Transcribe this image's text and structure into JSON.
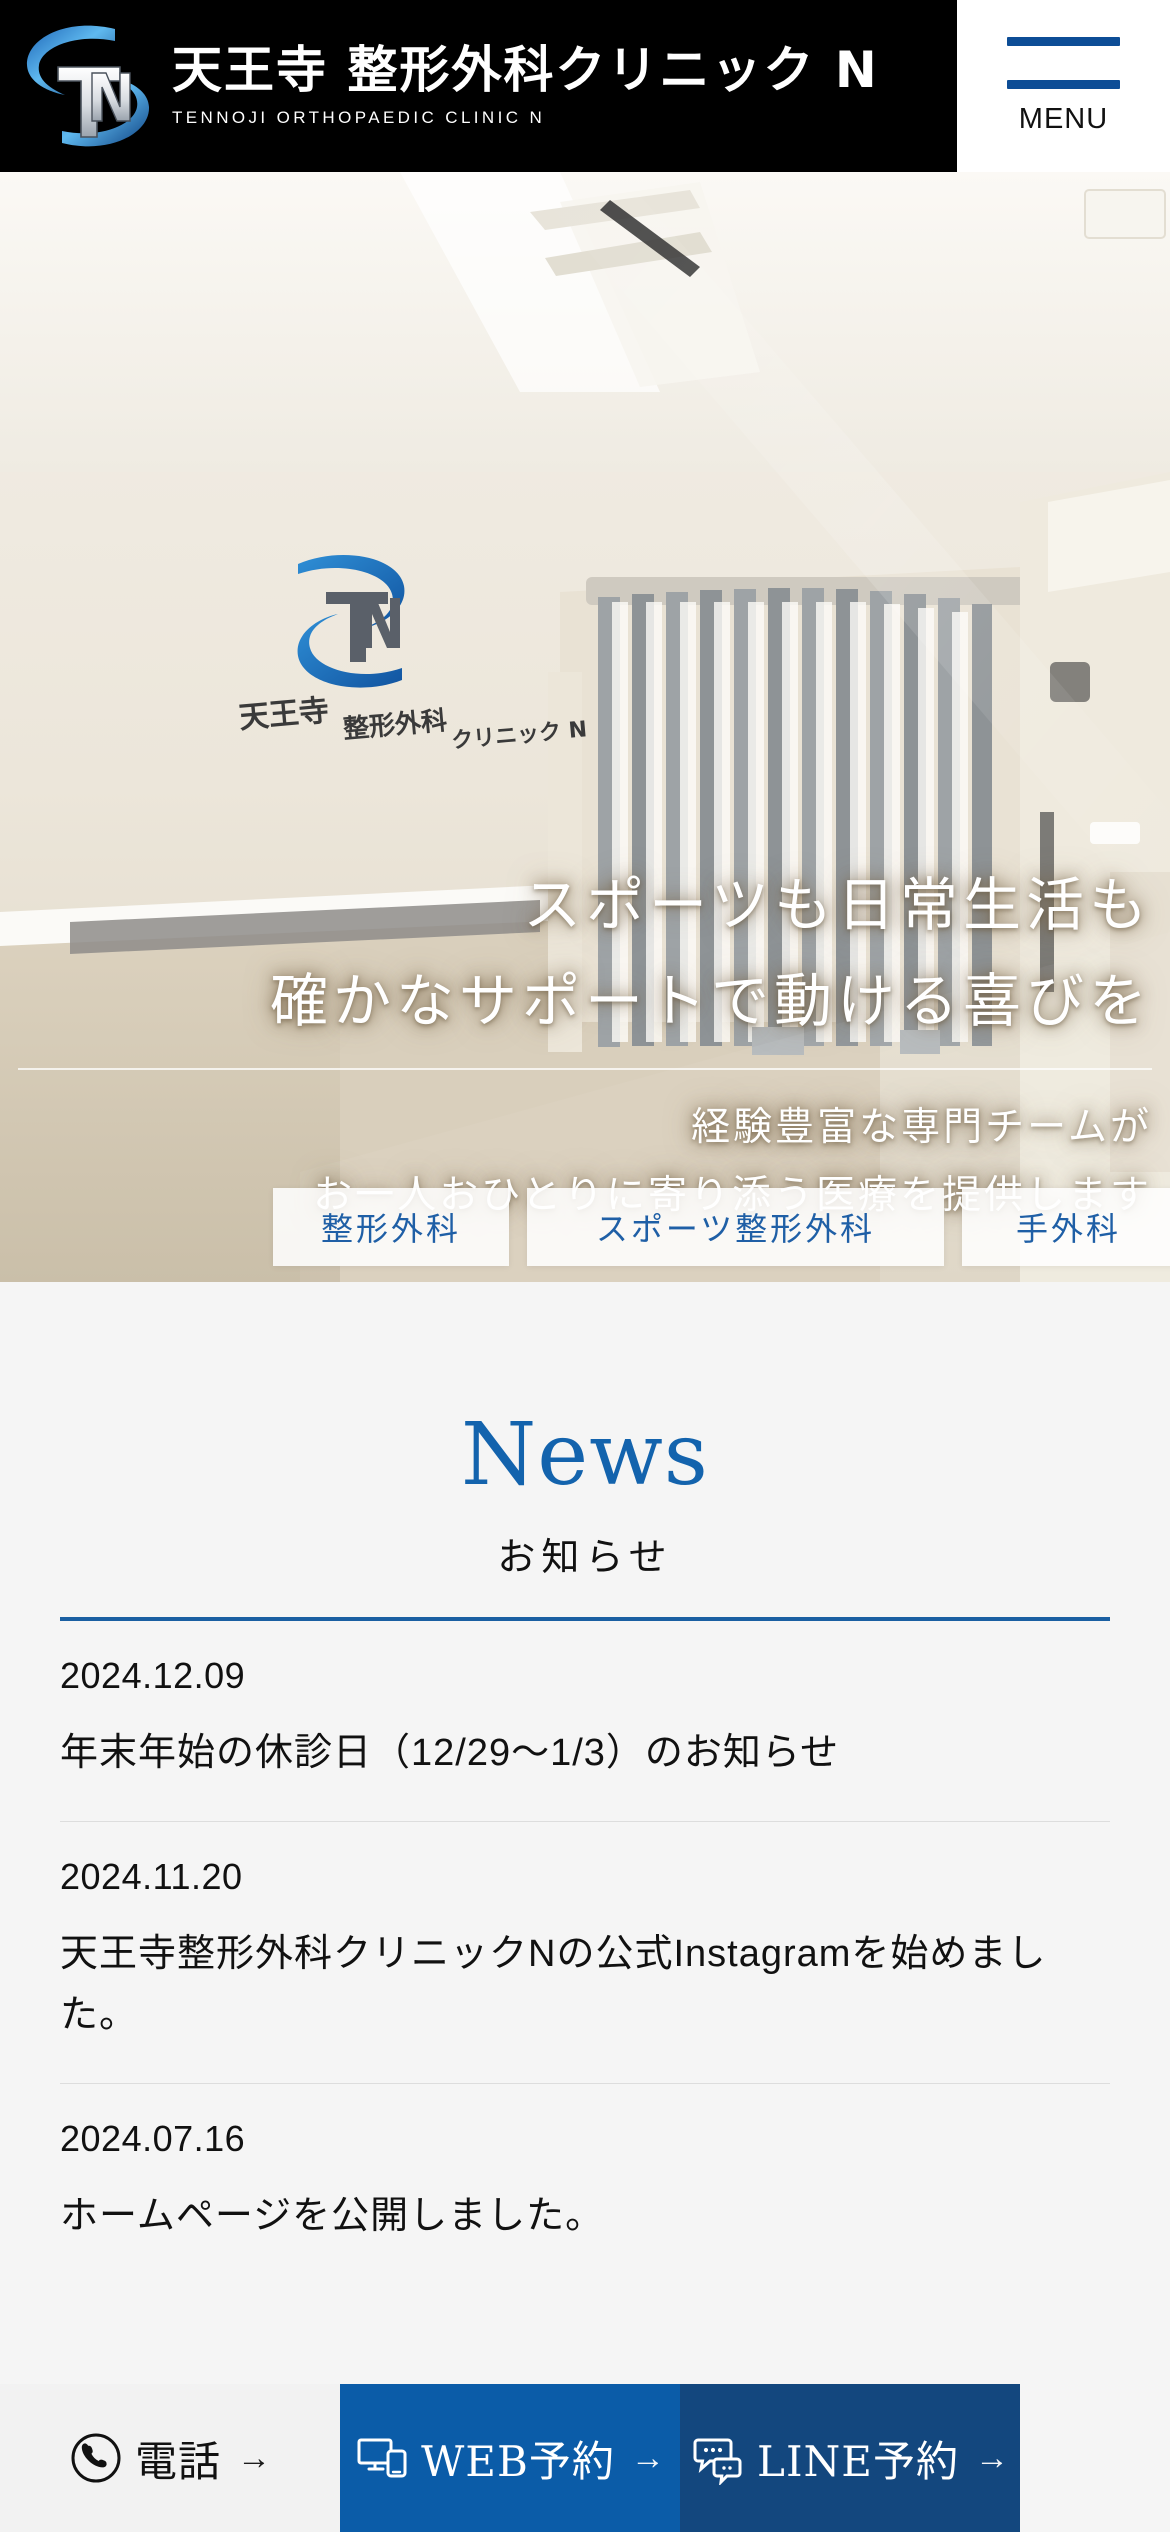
{
  "header": {
    "brand_jp": "天王寺 整形外科クリニック N",
    "brand_en": "TENNOJI  ORTHOPAEDIC CLINIC N",
    "menu_label": "MENU",
    "logo_letters": "TN",
    "colors": {
      "bar": "#000000",
      "accent": "#0d4d96"
    }
  },
  "hero": {
    "headline_line1": "スポーツも日常生活も",
    "headline_line2": "確かなサポートで動ける喜びを",
    "sub_line1": "経験豊富な専門チームが",
    "sub_line2": "お一人おひとりに寄り添う医療を提供します",
    "wall_logo_text": "天王寺 整形外科クリニック N",
    "tags": [
      {
        "label": "整形外科"
      },
      {
        "label": "スポーツ整形外科"
      },
      {
        "label": "手外科"
      }
    ]
  },
  "news": {
    "title": "News",
    "subtitle": "お知らせ",
    "accent_color": "#1363ad",
    "items": [
      {
        "date": "2024.12.09",
        "text": "年末年始の休診日（12/29〜1/3）のお知らせ"
      },
      {
        "date": "2024.11.20",
        "text": "天王寺整形外科クリニックNの公式Instagramを始めました。"
      },
      {
        "date": "2024.07.16",
        "text": "ホームページを公開しました。"
      }
    ]
  },
  "actionbar": {
    "items": [
      {
        "label": "電話",
        "icon": "phone-icon",
        "arrow": "→",
        "bg": "#f2f2f2",
        "fg": "#111111"
      },
      {
        "label": "WEB予約",
        "icon": "monitor-device-icon",
        "arrow": "→",
        "bg": "#0b5ca8",
        "fg": "#ffffff"
      },
      {
        "label": "LINE予約",
        "icon": "chat-bubbles-icon",
        "arrow": "→",
        "bg": "#13477e",
        "fg": "#ffffff"
      }
    ]
  }
}
